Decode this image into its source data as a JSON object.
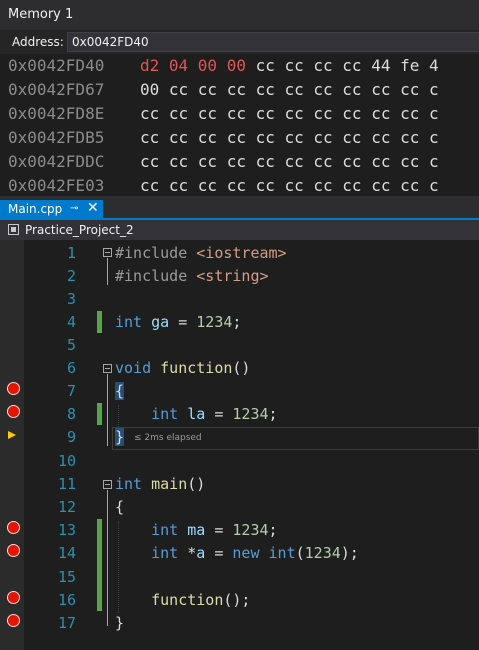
{
  "memory_window": {
    "title": "Memory 1",
    "address_label": "Address:",
    "address_value": "0x0042FD40",
    "rows": [
      {
        "addr": "0x0042FD40",
        "changed": "d2 04 00 00",
        "bytes": " cc cc cc cc 44 fe 4"
      },
      {
        "addr": "0x0042FD67",
        "changed": "",
        "bytes": "00 cc cc cc cc cc cc cc cc cc c"
      },
      {
        "addr": "0x0042FD8E",
        "changed": "",
        "bytes": "cc cc cc cc cc cc cc cc cc cc c"
      },
      {
        "addr": "0x0042FDB5",
        "changed": "",
        "bytes": "cc cc cc cc cc cc cc cc cc cc c"
      },
      {
        "addr": "0x0042FDDC",
        "changed": "",
        "bytes": "cc cc cc cc cc cc cc cc cc cc c"
      },
      {
        "addr": "0x0042FE03",
        "changed": "",
        "bytes": "cc cc cc cc cc cc cc cc cc cc c"
      }
    ]
  },
  "editor_tab": {
    "file_name": "Main.cpp",
    "pin_icon": "pin-icon",
    "close_icon": "close-icon"
  },
  "navigation": {
    "project_name": "Practice_Project_2",
    "project_icon": "project-icon"
  },
  "code": {
    "line_numbers": [
      "1",
      "2",
      "3",
      "4",
      "5",
      "6",
      "7",
      "8",
      "9",
      "10",
      "11",
      "12",
      "13",
      "14",
      "15",
      "16",
      "17"
    ],
    "breakpoint_lines": [
      7,
      8,
      13,
      14,
      16,
      17
    ],
    "current_line": 9,
    "perf_tip": "≤ 2ms elapsed",
    "tokens": {
      "include": "#include",
      "iostream": "<iostream>",
      "string": "<string>",
      "int": "int",
      "void": "void",
      "new": "new",
      "function_name": "function",
      "main_name": "main",
      "ga": "ga",
      "la": "la",
      "ma": "ma",
      "a": "a",
      "value": "1234"
    }
  },
  "colors": {
    "accent": "#007acc",
    "breakpoint": "#e51400",
    "instruction_pointer": "#ffcc00",
    "change_bar": "#57a64a",
    "changed_bytes": "#e05555"
  }
}
